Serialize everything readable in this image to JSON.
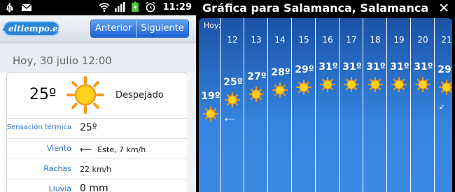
{
  "status_bar": {
    "time": "11:29"
  },
  "left_app": {
    "logo_text": "eltiempo.es",
    "nav": {
      "prev_label": "Anterior",
      "next_label": "Siguiente"
    },
    "date_label": "Hoy, 30 julio 12:00",
    "current": {
      "temp": "25º",
      "condition": "Despejado",
      "icon": "sun-icon"
    },
    "details": [
      {
        "label": "Sensación térmica",
        "value": "25º"
      },
      {
        "label": "Viento",
        "value": "Este, 7 km/h",
        "icon": "wind-arrow-icon"
      },
      {
        "label": "Rachas",
        "value": "22 km/h"
      },
      {
        "label": "Lluvia",
        "value": "0 mm"
      }
    ]
  },
  "right_app": {
    "title": "Gráfica para Salamanca, Salamanca",
    "hoy_label": "Hoy:",
    "close_icon": "close-icon",
    "columns": [
      {
        "day": "",
        "temp": "19º"
      },
      {
        "day": "12",
        "temp": "25º"
      },
      {
        "day": "13",
        "temp": "27º"
      },
      {
        "day": "14",
        "temp": "28º"
      },
      {
        "day": "15",
        "temp": "29º"
      },
      {
        "day": "16",
        "temp": "31º"
      },
      {
        "day": "17",
        "temp": "31º"
      },
      {
        "day": "18",
        "temp": "31º"
      },
      {
        "day": "19",
        "temp": "31º"
      },
      {
        "day": "20",
        "temp": "31º"
      },
      {
        "day": "21",
        "temp": "29º"
      }
    ]
  },
  "colors": {
    "sun_orange": "#f59a1a",
    "sun_yellow": "#ffd21c",
    "chart_blue": "#2f78d4",
    "label_blue": "#2a6fc9"
  }
}
